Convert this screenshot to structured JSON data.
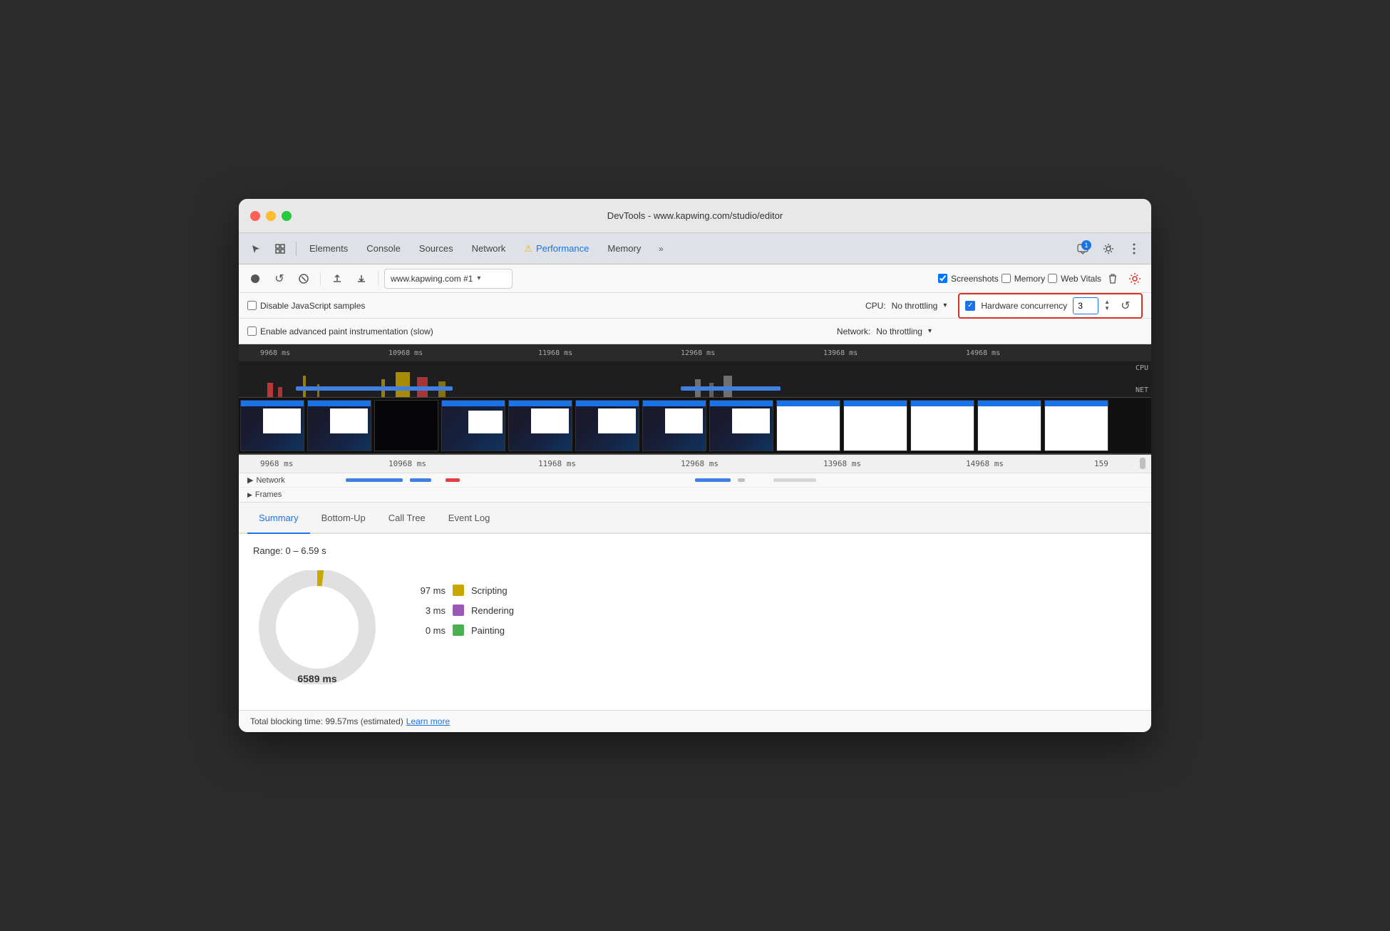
{
  "window": {
    "title": "DevTools - www.kapwing.com/studio/editor"
  },
  "tabs": {
    "items": [
      {
        "label": "Elements",
        "active": false
      },
      {
        "label": "Console",
        "active": false
      },
      {
        "label": "Sources",
        "active": false
      },
      {
        "label": "Network",
        "active": false
      },
      {
        "label": "Performance",
        "active": true
      },
      {
        "label": "Memory",
        "active": false
      }
    ],
    "more_label": "»",
    "notification_count": "1"
  },
  "toolbar": {
    "record_label": "●",
    "reload_label": "↺",
    "stop_label": "⊘",
    "upload_label": "⬆",
    "download_label": "⬇",
    "url_text": "www.kapwing.com #1",
    "screenshots_label": "Screenshots",
    "memory_label": "Memory",
    "web_vitals_label": "Web Vitals",
    "settings_icon": "⚙",
    "trash_icon": "🗑"
  },
  "options": {
    "disable_js_samples": "Disable JavaScript samples",
    "enable_paint": "Enable advanced paint instrumentation (slow)",
    "cpu_label": "CPU:",
    "cpu_throttle": "No throttling",
    "network_label": "Network:",
    "network_throttle": "No throttling",
    "hw_concurrency_label": "Hardware concurrency",
    "hw_concurrency_value": "3"
  },
  "timeline": {
    "ruler_labels": [
      "9968 ms",
      "10968 ms",
      "11968 ms",
      "12968 ms",
      "13968 ms",
      "14968 ms"
    ],
    "lower_ruler_labels": [
      "9968 ms",
      "10968 ms",
      "11968 ms",
      "12968 ms",
      "13968 ms",
      "14968 ms",
      "159"
    ],
    "cpu_label": "CPU",
    "net_label": "NET",
    "network_label": "▶ Network",
    "frames_label": "Frames"
  },
  "bottom_tabs": {
    "items": [
      {
        "label": "Summary",
        "active": true
      },
      {
        "label": "Bottom-Up",
        "active": false
      },
      {
        "label": "Call Tree",
        "active": false
      },
      {
        "label": "Event Log",
        "active": false
      }
    ]
  },
  "summary": {
    "range_text": "Range: 0 – 6.59 s",
    "center_ms": "6589 ms",
    "legend": [
      {
        "value": "97 ms",
        "color": "#c8a800",
        "label": "Scripting"
      },
      {
        "value": "3 ms",
        "color": "#9b59b6",
        "label": "Rendering"
      },
      {
        "value": "0 ms",
        "color": "#4caf50",
        "label": "Painting"
      }
    ]
  },
  "status_bar": {
    "text": "Total blocking time: 99.57ms (estimated)",
    "link_label": "Learn more"
  }
}
